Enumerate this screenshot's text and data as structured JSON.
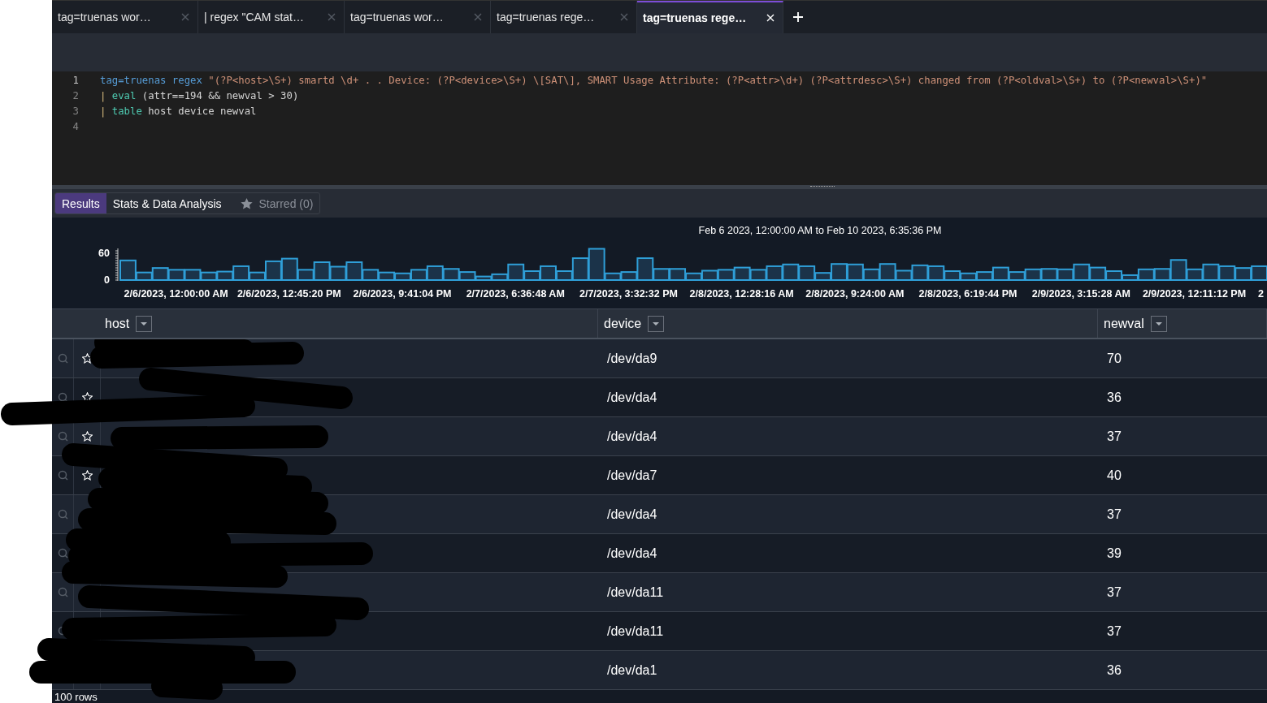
{
  "tabs": [
    {
      "label": "tag=truenas wor…",
      "selected": false
    },
    {
      "label": "| regex \"CAM stat…",
      "selected": false
    },
    {
      "label": "tag=truenas wor…",
      "selected": false
    },
    {
      "label": "tag=truenas rege…",
      "selected": false
    },
    {
      "label": "tag=truenas rege…",
      "selected": true
    }
  ],
  "editor": {
    "lines": [
      {
        "number": "1",
        "tokens": [
          {
            "kind": "keyword",
            "text": "tag=truenas regex"
          },
          {
            "kind": "string",
            "text": "\"(?P<host>\\S+) smartd \\d+ . . Device: (?P<device>\\S+) \\[SAT\\], SMART Usage Attribute: (?P<attr>\\d+) (?P<attrdesc>\\S+) changed from (?P<oldval>\\S+) to (?P<newval>\\S+)\""
          }
        ]
      },
      {
        "number": "2",
        "tokens": [
          {
            "kind": "pipe",
            "text": "|"
          },
          {
            "kind": "command",
            "text": "eval"
          },
          {
            "kind": "plain",
            "text": "(attr==194 && newval > 30)"
          }
        ]
      },
      {
        "number": "3",
        "tokens": [
          {
            "kind": "pipe",
            "text": "|"
          },
          {
            "kind": "command",
            "text": "table"
          },
          {
            "kind": "plain",
            "text": "host device newval"
          }
        ]
      },
      {
        "number": "4"
      }
    ]
  },
  "result_tabs": [
    {
      "label": "Results",
      "selected": true,
      "disabled": false
    },
    {
      "label": "Stats & Data Analysis",
      "selected": false,
      "disabled": false
    },
    {
      "label": "Starred (0)",
      "selected": false,
      "disabled": true
    }
  ],
  "chart": {
    "chart_data": {
      "type": "bar",
      "title": "Feb 6 2023, 12:00:00 AM to Feb 10 2023, 6:35:36 PM",
      "ylim": [
        0,
        70
      ],
      "yticks": [
        0,
        60
      ],
      "categories": [
        null,
        null,
        null,
        "2/6/2023, 12:00:00 AM",
        null,
        null,
        null,
        null,
        null,
        null,
        "2/6/2023, 12:45:20 PM",
        null,
        null,
        null,
        null,
        null,
        null,
        "2/6/2023, 9:41:04 PM",
        null,
        null,
        null,
        null,
        null,
        null,
        "2/7/2023, 6:36:48 AM",
        null,
        null,
        null,
        null,
        null,
        null,
        "2/7/2023, 3:32:32 PM",
        null,
        null,
        null,
        null,
        null,
        null,
        "2/8/2023, 12:28:16 AM",
        null,
        null,
        null,
        null,
        null,
        null,
        "2/8/2023, 9:24:00 AM",
        null,
        null,
        null,
        null,
        null,
        null,
        "2/8/2023, 6:19:44 PM",
        null,
        null,
        null,
        null,
        null,
        null,
        "2/9/2023, 3:15:28 AM",
        null,
        null,
        null,
        null,
        null,
        null,
        "2/9/2023, 12:11:12 PM",
        null,
        null,
        null,
        null
      ],
      "values": [
        44,
        17,
        27,
        23,
        23,
        17,
        19,
        31,
        17,
        42,
        48,
        23,
        40,
        30,
        40,
        23,
        17,
        15,
        23,
        31,
        25,
        18,
        8,
        13,
        35,
        20,
        31,
        20,
        49,
        70,
        15,
        18,
        49,
        25,
        25,
        15,
        21,
        23,
        28,
        23,
        31,
        35,
        31,
        16,
        36,
        35,
        24,
        36,
        21,
        33,
        31,
        20,
        15,
        18,
        28,
        18,
        24,
        25,
        24,
        35,
        28,
        20,
        11,
        24,
        25,
        45,
        24,
        35,
        31,
        27,
        31
      ]
    },
    "cut_axis_label": "2"
  },
  "table": {
    "columns": [
      "host",
      "device",
      "newval"
    ],
    "rows": [
      {
        "device": "/dev/da9",
        "newval": "70"
      },
      {
        "device": "/dev/da4",
        "newval": "36"
      },
      {
        "device": "/dev/da4",
        "newval": "37"
      },
      {
        "device": "/dev/da7",
        "newval": "40"
      },
      {
        "device": "/dev/da4",
        "newval": "37"
      },
      {
        "device": "/dev/da4",
        "newval": "39"
      },
      {
        "device": "/dev/da11",
        "newval": "37"
      },
      {
        "device": "/dev/da11",
        "newval": "37"
      },
      {
        "device": "/dev/da1",
        "newval": "36"
      }
    ]
  },
  "status_bar": {
    "row_count": "100 rows"
  }
}
